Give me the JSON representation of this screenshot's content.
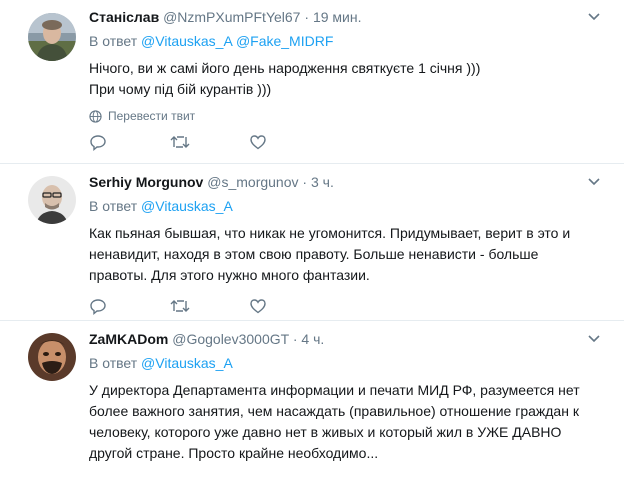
{
  "tweets": [
    {
      "fullname": "Станіслав",
      "username": "@NzmPXumPFtYel67",
      "separator": "·",
      "time": "19 мин.",
      "reply_prefix": "В ответ",
      "reply_handles": [
        "@Vitauskas_A",
        "@Fake_MIDRF"
      ],
      "text": "Нічого, ви ж самі його день народження святкуєте 1 січня )))\nПри чому під бій курантів )))",
      "translate_label": "Перевести твит"
    },
    {
      "fullname": "Serhiy Morgunov",
      "username": "@s_morgunov",
      "separator": "·",
      "time": "3 ч.",
      "reply_prefix": "В ответ",
      "reply_handles": [
        "@Vitauskas_A"
      ],
      "text": "Как пьяная бывшая, что никак не угомонится. Придумывает, верит в это и\nненавидит, находя в этом свою правоту. Больше ненависти - больше\nправоты. Для этого нужно много фантазии."
    },
    {
      "fullname": "ZaMKADom",
      "username": "@Gogolev3000GT",
      "separator": "·",
      "time": "4 ч.",
      "reply_prefix": "В ответ",
      "reply_handles": [
        "@Vitauskas_A"
      ],
      "text": "У директора Департамента информации и печати МИД РФ, разумеется нет\nболее важного занятия, чем насаждать (правильное) отношение граждан к\nчеловеку, которого уже давно нет в живых и который жил в УЖЕ ДАВНО\nдругой стране. Просто крайне необходимо..."
    }
  ],
  "colors": {
    "link": "#1da1f2",
    "secondary_text": "#657786",
    "divider": "#e6ecf0"
  },
  "icons": [
    "reply-icon",
    "retweet-icon",
    "like-icon",
    "more-caret-icon",
    "globe-icon"
  ]
}
